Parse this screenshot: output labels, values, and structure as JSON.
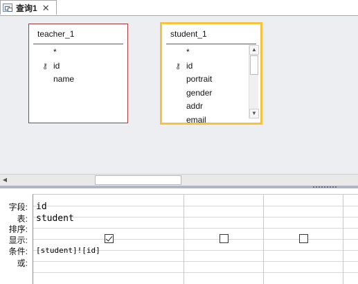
{
  "tab": {
    "label": "查询1",
    "close_glyph": "✕"
  },
  "tables": [
    {
      "title": "teacher_1",
      "fields": [
        "*",
        "id",
        "name"
      ]
    },
    {
      "title": "student_1",
      "fields": [
        "*",
        "id",
        "portrait",
        "gender",
        "addr",
        "email"
      ]
    }
  ],
  "grid": {
    "row_labels": [
      "字段:",
      "表:",
      "排序:",
      "显示:",
      "条件:",
      "或:"
    ],
    "columns": [
      {
        "field": "id",
        "table": "student",
        "sort": "",
        "show": true,
        "criteria": "[student]![id]",
        "or": ""
      },
      {
        "field": "",
        "table": "",
        "sort": "",
        "show": false,
        "criteria": "",
        "or": ""
      },
      {
        "field": "",
        "table": "",
        "sort": "",
        "show": false,
        "criteria": "",
        "or": ""
      }
    ]
  },
  "colors": {
    "selected_table_border": "#f7c33c",
    "table_border": "#a33b3b",
    "design_bg": "#eceef1"
  }
}
